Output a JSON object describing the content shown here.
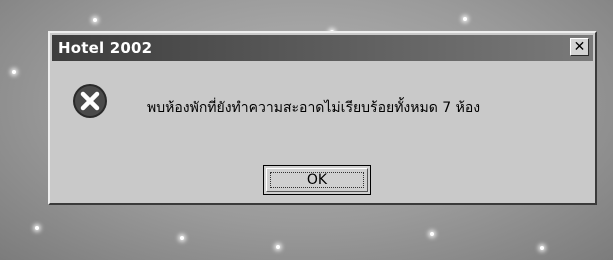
{
  "dialog": {
    "title": "Hotel 2002",
    "close_glyph": "✕",
    "icon": "error-icon",
    "message": "พบห้องพักที่ยังทำความสะอาดไม่เรียบร้อยทั้งหมด 7 ห้อง",
    "ok_label": "OK"
  }
}
